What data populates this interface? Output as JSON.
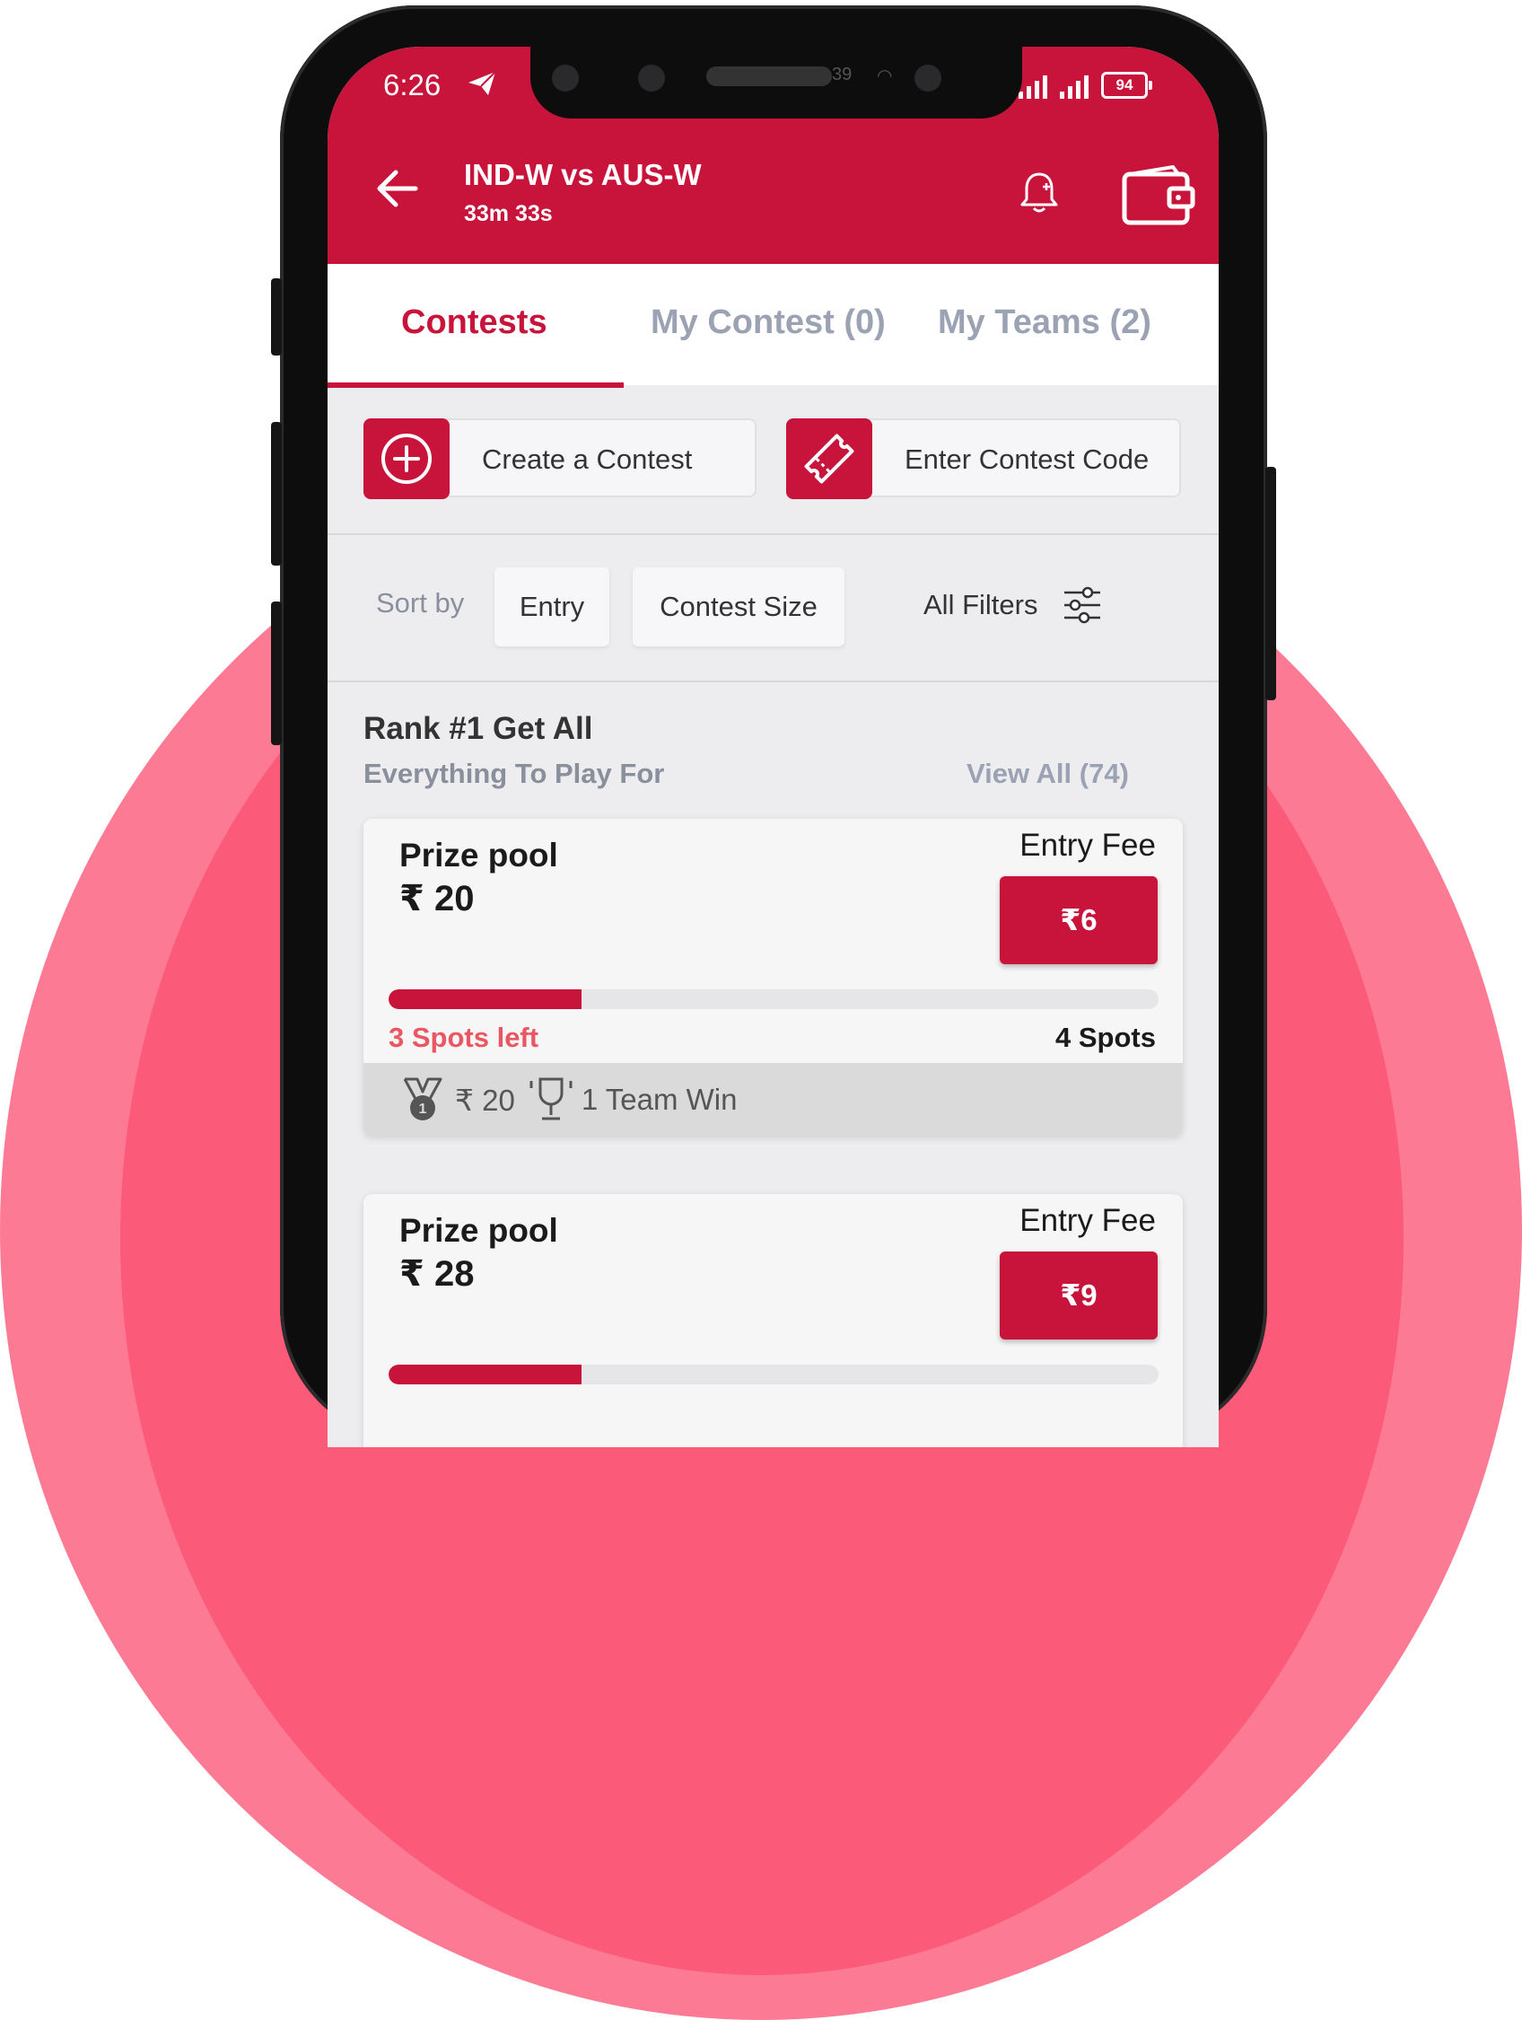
{
  "colors": {
    "brand": "#c8143a",
    "spots_left": "#ea5662",
    "background_outer": "#fd7a94",
    "background_inner": "#fc5a79"
  },
  "status_bar": {
    "time": "6:26",
    "notification_badge": "39",
    "battery": "94"
  },
  "header": {
    "title": "IND-W vs AUS-W",
    "countdown": "33m 33s",
    "icons": [
      "back-arrow-icon",
      "bell-icon",
      "wallet-icon"
    ]
  },
  "tabs": [
    {
      "label": "Contests",
      "active": true
    },
    {
      "label": "My Contest (0)",
      "active": false
    },
    {
      "label": "My Teams (2)",
      "active": false
    }
  ],
  "actions": {
    "create_label": "Create a Contest",
    "code_label": "Enter Contest Code"
  },
  "sort": {
    "label": "Sort by",
    "options": [
      "Entry",
      "Contest Size"
    ],
    "filters_label": "All Filters"
  },
  "section": {
    "title": "Rank #1 Get All",
    "subtitle": "Everything To Play For",
    "view_all": "View All (74)"
  },
  "contests": [
    {
      "prize_label": "Prize pool",
      "prize_value": "₹ 20",
      "fee_label": "Entry Fee",
      "fee": "₹6",
      "spots_left": "3 Spots left",
      "spots_total": "4 Spots",
      "fill_fraction": 0.25,
      "first_prize": "₹ 20",
      "winners": "1 Team Win"
    },
    {
      "prize_label": "Prize pool",
      "prize_value": "₹ 28",
      "fee_label": "Entry Fee",
      "fee": "₹9",
      "fill_fraction": 0.25
    }
  ]
}
